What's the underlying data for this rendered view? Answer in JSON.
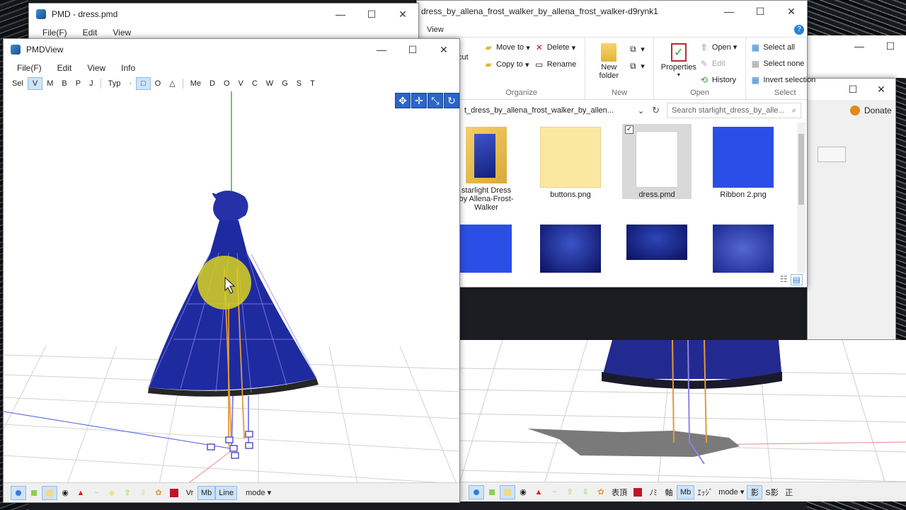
{
  "pmd_back": {
    "title": "PMD - dress.pmd",
    "menu": [
      "File(F)",
      "Edit",
      "View"
    ]
  },
  "explorer": {
    "title": "dress_by_allena_frost_walker_by_allena_frost_walker-d9rynk1",
    "tab": "View",
    "clipboard_partial": "cut",
    "organize": {
      "move_to": "Move to",
      "copy_to": "Copy to",
      "delete": "Delete",
      "rename": "Rename",
      "label": "Organize"
    },
    "new": {
      "new_folder": "New folder",
      "label": "New"
    },
    "open": {
      "properties": "Properties",
      "open": "Open",
      "edit": "Edit",
      "history": "History",
      "label": "Open"
    },
    "select": {
      "select_all": "Select all",
      "select_none": "Select none",
      "invert": "Invert selection",
      "label": "Select"
    },
    "address": "t_dress_by_allena_frost_walker_by_allen...",
    "search_placeholder": "Search starlight_dress_by_alle...",
    "files": [
      {
        "name": "starlight Dress by Allena-Frost-Walker",
        "kind": "folder"
      },
      {
        "name": "buttons.png",
        "kind": "image-yellow"
      },
      {
        "name": "dress.pmd",
        "kind": "file",
        "selected": true
      },
      {
        "name": "Ribbon 2.png",
        "kind": "image-blue"
      }
    ]
  },
  "donate": {
    "label": "Donate"
  },
  "pmdview": {
    "title": "PMDView",
    "menu": [
      "File(F)",
      "Edit",
      "View",
      "Info"
    ],
    "toolbar": [
      "Sel",
      "V",
      "M",
      "B",
      "P",
      "J",
      "Typ",
      "·",
      "□",
      "O",
      "△",
      "Me",
      "D",
      "O",
      "V",
      "C",
      "W",
      "G",
      "S",
      "T"
    ],
    "bottom": {
      "vr": "Vr",
      "line": "Line",
      "mode": "mode"
    }
  },
  "right_toolbar": {
    "mode": "mode",
    "labels": [
      "表頂",
      "ﾉﾐ",
      "軸",
      "ｴｯｼﾞ",
      "影",
      "S影",
      "正"
    ]
  },
  "colors": {
    "accent": "#2b66c9",
    "dress": "#1e2aa0",
    "bone": "#e39a3a",
    "highlight": "#d9d21f"
  }
}
